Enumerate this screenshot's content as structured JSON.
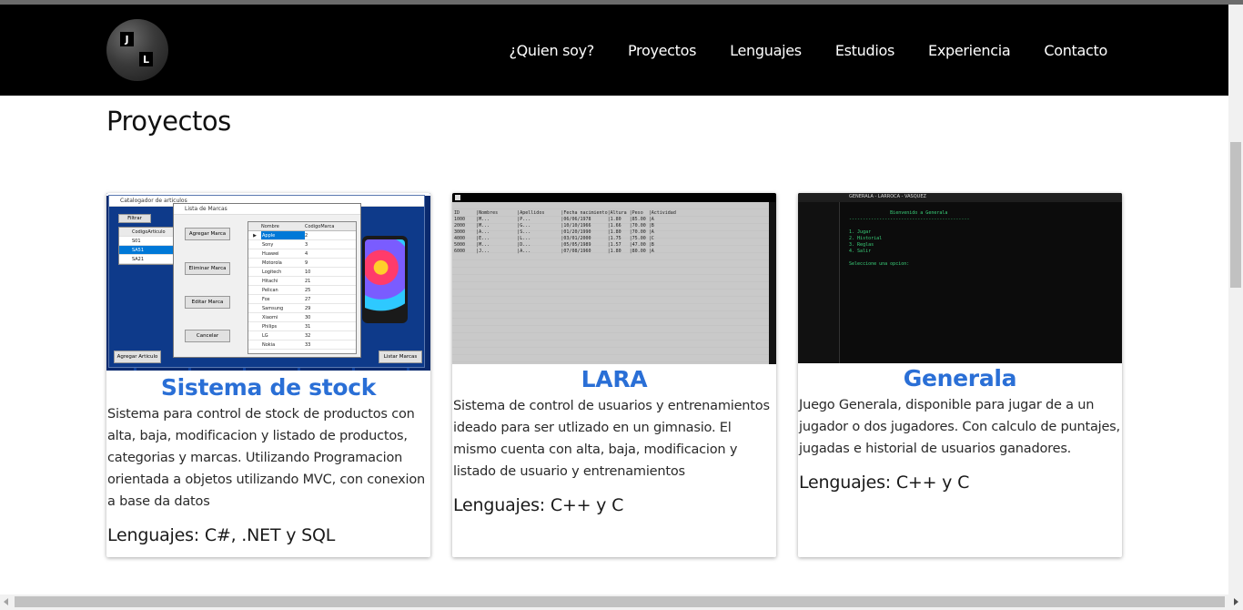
{
  "header": {
    "logo": {
      "letter_top": "J",
      "letter_bottom": "L"
    },
    "nav": [
      {
        "label": "¿Quien soy?"
      },
      {
        "label": "Proyectos"
      },
      {
        "label": "Lenguajes"
      },
      {
        "label": "Estudios"
      },
      {
        "label": "Experiencia"
      },
      {
        "label": "Contacto"
      }
    ]
  },
  "section": {
    "title": "Proyectos"
  },
  "projects": [
    {
      "title": "Sistema de stock",
      "description": "Sistema para control de stock de productos con alta, baja, modificacion y listado de productos, categorias y marcas. Utilizando Programacion orientada a objetos utilizando MVC, con conexion a base da datos",
      "languages": "Lenguajes: C#, .NET y SQL",
      "screenshot": {
        "main_window_title": "Catalogador de articulos",
        "dialog_title": "Lista de Marcas",
        "filter_button": "Filtrar",
        "list_header": "CodigoArticulo",
        "list_items": [
          "S01",
          "SA51",
          "SA21"
        ],
        "buttons": [
          "Agregar Marca",
          "Eliminar Marca",
          "Editar Marca",
          "Cancelar"
        ],
        "columns": [
          "Nombre",
          "CodigoMarca"
        ],
        "rows": [
          [
            "Apple",
            "2"
          ],
          [
            "Sony",
            "3"
          ],
          [
            "Huawei",
            "4"
          ],
          [
            "Motorola",
            "9"
          ],
          [
            "Logitech",
            "10"
          ],
          [
            "Hitachi",
            "21"
          ],
          [
            "Pelican",
            "25"
          ],
          [
            "Fox",
            "27"
          ],
          [
            "Samsung",
            "29"
          ],
          [
            "Xiaomi",
            "30"
          ],
          [
            "Philips",
            "31"
          ],
          [
            "LG",
            "32"
          ],
          [
            "Nokia",
            "33"
          ]
        ],
        "bottom_buttons": [
          "Agregar Articulo",
          "Listar Marcas"
        ]
      }
    },
    {
      "title": "LARA",
      "description": "Sistema de control de usuarios y entrenamientos ideado para ser utlizado en un gimnasio. El mismo cuenta con alta, baja, modificacion y listado de usuario y entrenamientos",
      "languages": "Lenguajes: C++ y C"
    },
    {
      "title": "Generala",
      "description": "Juego Generala, disponible para jugar de a un jugador o dos jugadores. Con calculo de puntajes, jugadas e historial de usuarios ganadores.",
      "languages": "Lenguajes: C++ y C",
      "screenshot": {
        "window_title": "GENERALA - LARROCA - VASQUEZ"
      }
    }
  ]
}
